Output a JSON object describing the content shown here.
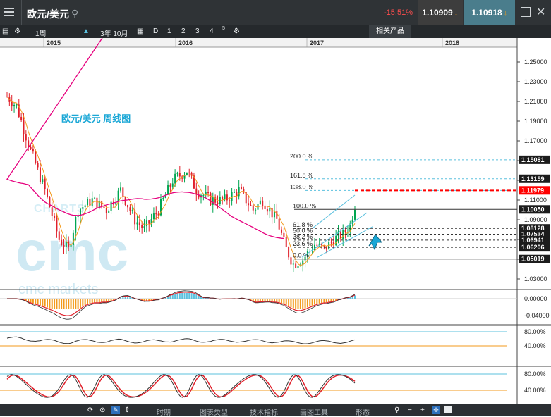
{
  "header": {
    "instrument": "欧元/美元",
    "change": "-15.51%",
    "bid": "1.10909",
    "ask": "1.10918"
  },
  "toolbar": {
    "timeframe": "1周",
    "range": "3年 10月",
    "periods": [
      "D",
      "1",
      "2",
      "3",
      "4",
      "5"
    ],
    "related": "相关产品"
  },
  "chart_data": {
    "type": "candlestick",
    "title": "欧元/美元 周线图",
    "watermark": [
      "CHARTS",
      "cmc",
      "cmc markets"
    ],
    "x_labels": [
      "2015",
      "2016",
      "2017",
      "2018"
    ],
    "y_ticks": [
      "1.25000",
      "1.23000",
      "1.21000",
      "1.19000",
      "1.17000",
      "1.15000",
      "1.13000",
      "1.11000",
      "1.09000",
      "1.07000",
      "1.05000",
      "1.03000"
    ],
    "ylim": [
      1.02,
      1.265
    ],
    "fib_levels": [
      {
        "label": "200.0 %",
        "value": 1.15081
      },
      {
        "label": "161.8 %",
        "value": 1.13159
      },
      {
        "label": "138.0 %",
        "value": 1.1197
      },
      {
        "label": "100.0 %",
        "value": 1.1005
      },
      {
        "label": "61.8 %",
        "value": 1.08128
      },
      {
        "label": "50.0 %",
        "value": 1.07534
      },
      {
        "label": "38.2 %",
        "value": 1.06941
      },
      {
        "label": "23.6 %",
        "value": 1.06206
      },
      {
        "label": "0.0 %",
        "value": 1.05019
      }
    ],
    "price_tags": [
      {
        "value": "1.15081",
        "style": "normal"
      },
      {
        "value": "1.13159",
        "style": "normal"
      },
      {
        "value": "1.11979",
        "style": "red"
      },
      {
        "value": "1.10050",
        "style": "normal"
      },
      {
        "value": "1.08128",
        "style": "normal"
      },
      {
        "value": "1.07534",
        "style": "normal"
      },
      {
        "value": "1.06941",
        "style": "normal"
      },
      {
        "value": "1.06206",
        "style": "normal"
      },
      {
        "value": "1.05019",
        "style": "normal"
      }
    ],
    "current_level": 1.1197,
    "macd_ticks": [
      "0.00000",
      "-0.04000"
    ],
    "osc1_ticks": [
      "80.00%",
      "40.00%"
    ],
    "osc2_ticks": [
      "80.00%",
      "40.00%"
    ]
  },
  "bottom": {
    "tabs": [
      "时期",
      "图表类型",
      "技术指标",
      "画图工具",
      "形态"
    ]
  },
  "colors": {
    "up": "#00a651",
    "down": "#e0202b",
    "ma_slow": "#e6007e",
    "ma_fast": "#f39a1b",
    "channel": "#5bc0de"
  }
}
